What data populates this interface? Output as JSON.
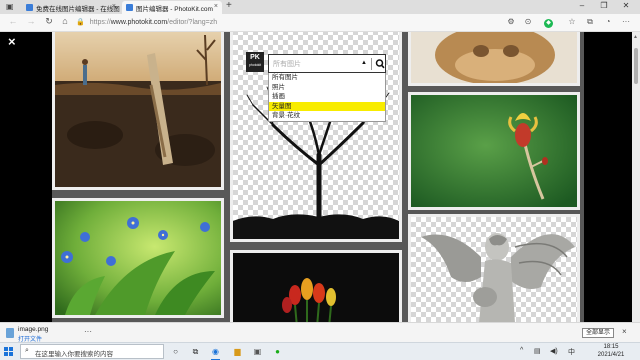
{
  "browser": {
    "tabs": [
      {
        "label": "免费在线图片编辑器 - 在线图页",
        "active": false
      },
      {
        "label": "图片编辑器 - PhotoKit.com",
        "active": true
      }
    ],
    "new_tab_label": "+",
    "url": {
      "scheme": "https://",
      "host": "www.photokit.com",
      "path": "/editor/?lang=zh"
    }
  },
  "page": {
    "close_label": "×",
    "filter": {
      "logo_main": "PK",
      "logo_sub": "photokit",
      "placeholder": "所有图片",
      "options": [
        "所有图片",
        "照片",
        "插画",
        "矢量图",
        "背景·花纹"
      ],
      "highlighted_index": 3
    }
  },
  "download": {
    "filename": "image.png",
    "open_label": "打开文件",
    "more": "···",
    "show_all_label": "全部显示",
    "close": "×"
  },
  "taskbar": {
    "search_placeholder": "在这里输入你要搜索的内容",
    "tray_lang": "中",
    "time": "18:15",
    "date": "2021/4/21"
  },
  "colors": {
    "highlight": "#f8ec00",
    "gallery_bg": "#585858",
    "active_link": "#1a6ad6"
  }
}
